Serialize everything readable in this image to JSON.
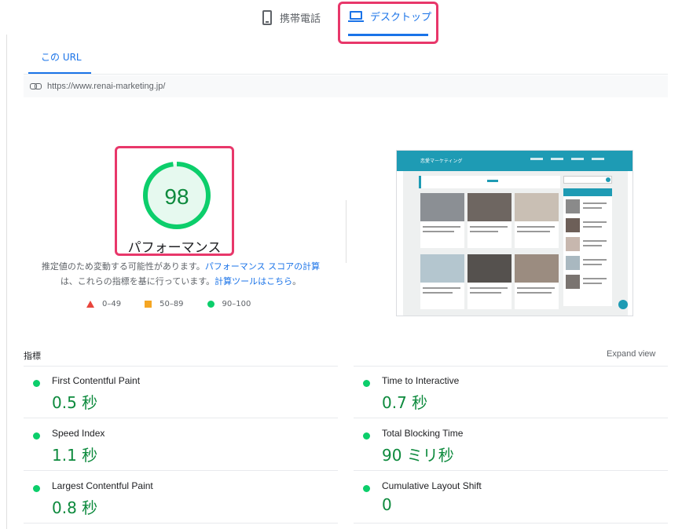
{
  "device_tabs": {
    "mobile_label": "携帯電話",
    "desktop_label": "デスクトップ"
  },
  "url_tab": {
    "label": "この URL"
  },
  "url_bar": {
    "url": "https://www.renai-marketing.jp/"
  },
  "score": {
    "value": "98",
    "fraction": 0.98,
    "label": "パフォーマンス",
    "color": "#0cce6b"
  },
  "explanation": {
    "text1": "推定値のため変動する可能性があります。",
    "link1": "パフォーマンス スコアの計算",
    "text2": "は、これらの指標を基に行っています。",
    "link2": "計算ツールはこちら",
    "text3": "。"
  },
  "legend": [
    {
      "range": "0–49",
      "shape": "triangle",
      "color": "#e8453c"
    },
    {
      "range": "50–89",
      "shape": "square",
      "color": "#f5a623"
    },
    {
      "range": "90–100",
      "shape": "circle",
      "color": "#0cce6b"
    }
  ],
  "thumbnail": {
    "site_title": "恋愛マーケティング"
  },
  "metrics": {
    "title": "指標",
    "expand_label": "Expand view",
    "items": [
      {
        "name": "First Contentful Paint",
        "value": "0.5 秒"
      },
      {
        "name": "Time to Interactive",
        "value": "0.7 秒"
      },
      {
        "name": "Speed Index",
        "value": "1.1 秒"
      },
      {
        "name": "Total Blocking Time",
        "value": "90 ミリ秒"
      },
      {
        "name": "Largest Contentful Paint",
        "value": "0.8 秒"
      },
      {
        "name": "Cumulative Layout Shift",
        "value": "0"
      }
    ]
  }
}
